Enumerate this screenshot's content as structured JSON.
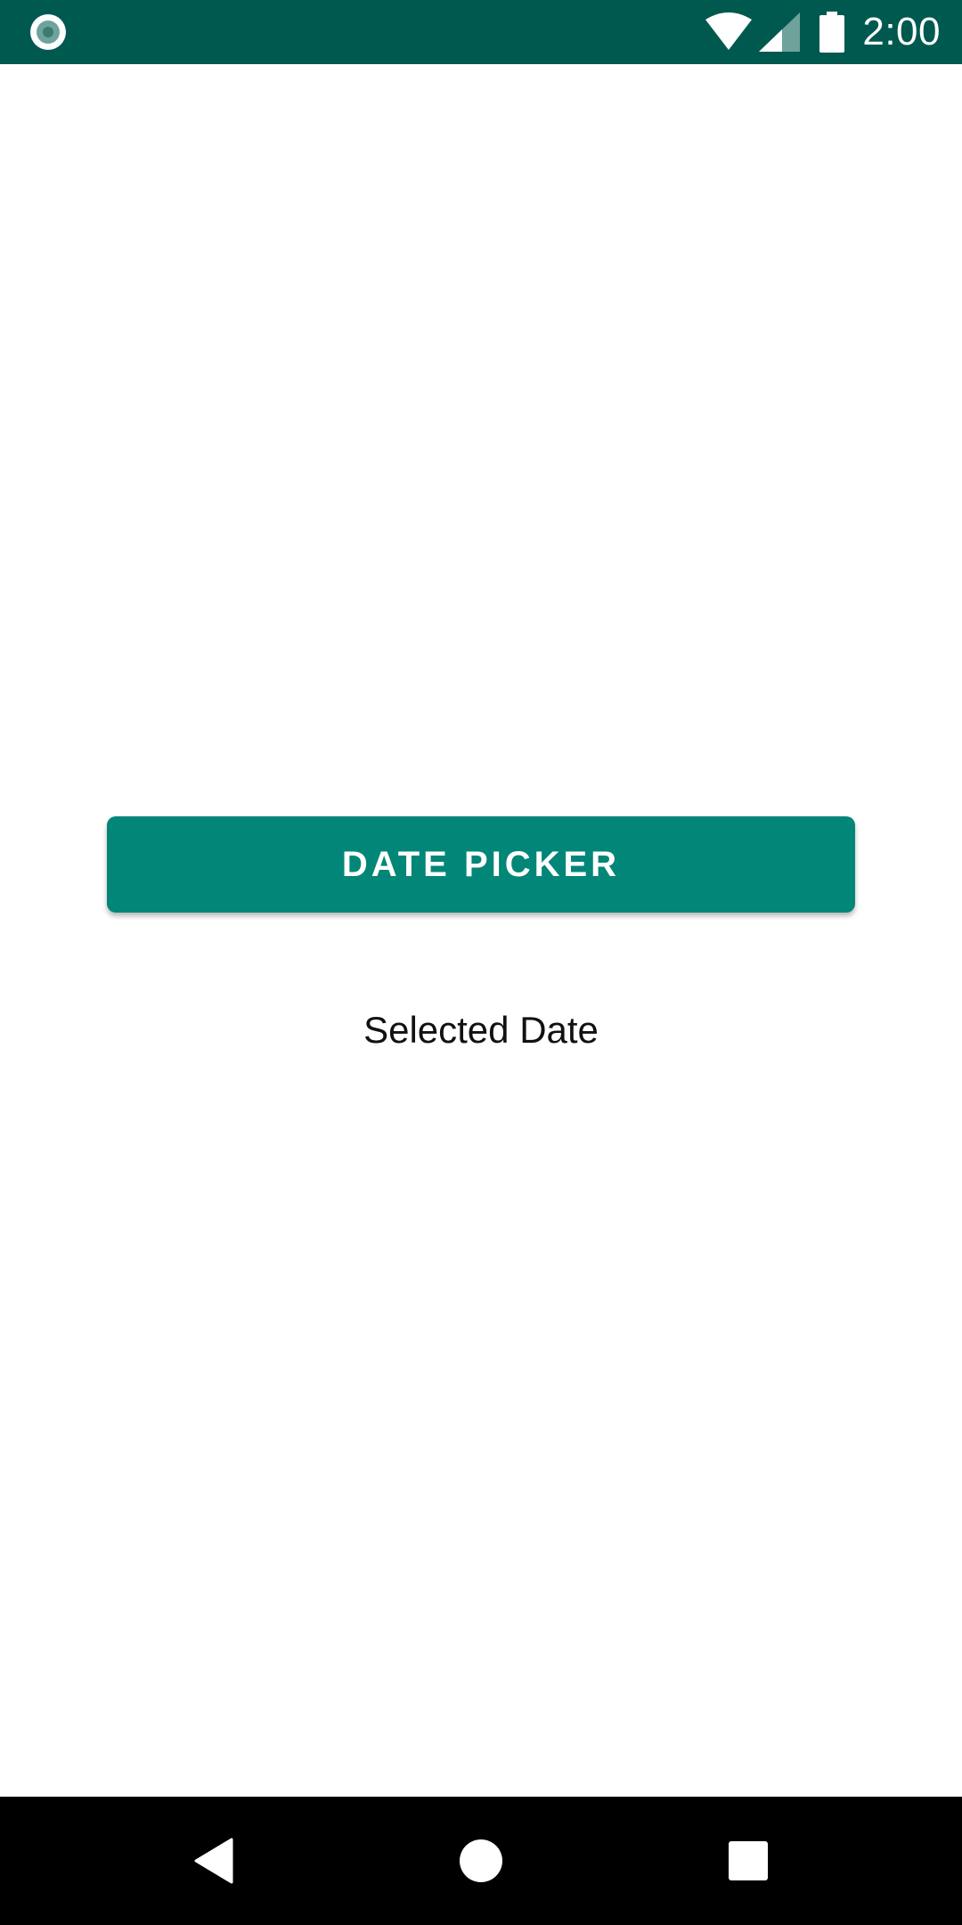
{
  "status_bar": {
    "time": "2:00",
    "left_icon": "record-indicator-icon",
    "icons": [
      "wifi-icon",
      "cellular-signal-icon",
      "battery-icon"
    ],
    "background_color": "#00594f"
  },
  "main": {
    "date_picker_button_label": "DATE PICKER",
    "selected_date_text": "Selected Date",
    "accent_color": "#028678"
  },
  "nav_bar": {
    "buttons": [
      "back-icon",
      "home-icon",
      "recents-icon"
    ]
  }
}
